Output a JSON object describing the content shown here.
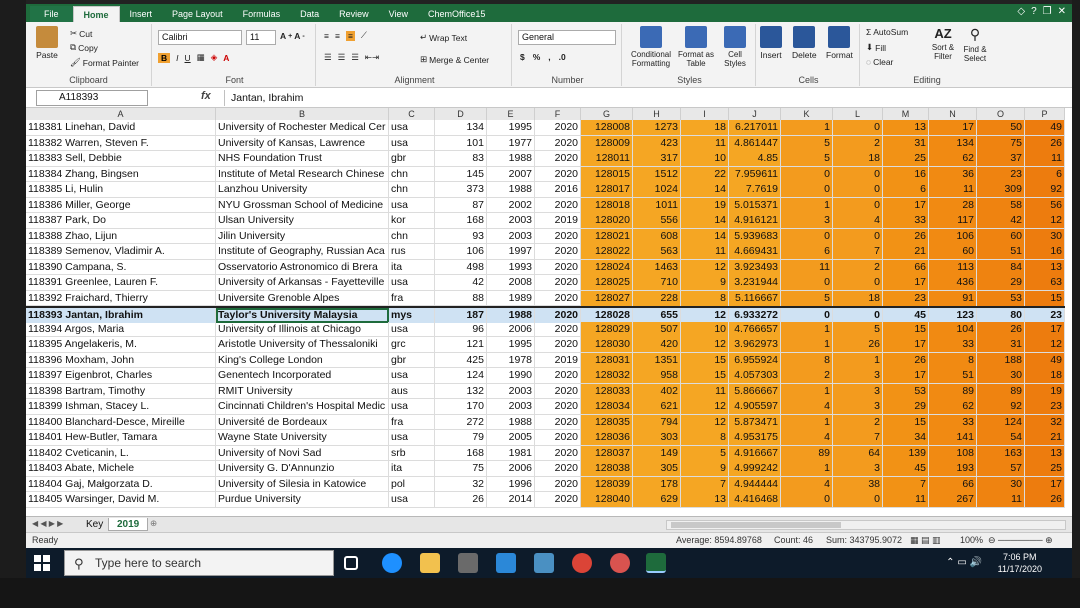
{
  "ribbon_tabs": [
    "File",
    "Home",
    "Insert",
    "Page Layout",
    "Formulas",
    "Data",
    "Review",
    "View",
    "ChemOffice15"
  ],
  "ribbon": {
    "clipboard": {
      "paste": "Paste",
      "cut": "Cut",
      "copy": "Copy",
      "format_painter": "Format Painter",
      "label": "Clipboard"
    },
    "font": {
      "name": "Calibri",
      "size": "11",
      "label": "Font"
    },
    "alignment": {
      "wrap": "Wrap Text",
      "merge": "Merge & Center",
      "label": "Alignment"
    },
    "number": {
      "format": "General",
      "label": "Number"
    },
    "styles": {
      "conditional": "Conditional Formatting",
      "table": "Format as Table",
      "cell": "Cell Styles",
      "label": "Styles"
    },
    "cells": {
      "insert": "Insert",
      "delete": "Delete",
      "format": "Format",
      "label": "Cells"
    },
    "editing": {
      "autosum": "AutoSum",
      "fill": "Fill",
      "clear": "Clear",
      "sort": "Sort & Filter",
      "find": "Find & Select",
      "label": "Editing"
    }
  },
  "formula_bar": {
    "name_box": "A118393",
    "fx": "fx",
    "content": "Jantan, Ibrahim"
  },
  "columns": [
    "A",
    "B",
    "C",
    "D",
    "E",
    "F",
    "G",
    "H",
    "I",
    "J",
    "K",
    "L",
    "M",
    "N",
    "O",
    "P"
  ],
  "rows": [
    {
      "a": "118381 Linehan, David",
      "b": "University of Rochester Medical Cer",
      "c": "usa",
      "d": "134",
      "e": "1995",
      "f": "2020",
      "g": "128008",
      "h": "1273",
      "i": "18",
      "j": "6.217011",
      "k": "1",
      "l": "0",
      "m": "13",
      "n": "17",
      "o": "50",
      "p": "49"
    },
    {
      "a": "118382 Warren, Steven F.",
      "b": "University of Kansas, Lawrence",
      "c": "usa",
      "d": "101",
      "e": "1977",
      "f": "2020",
      "g": "128009",
      "h": "423",
      "i": "11",
      "j": "4.861447",
      "k": "5",
      "l": "2",
      "m": "31",
      "n": "134",
      "o": "75",
      "p": "26"
    },
    {
      "a": "118383 Sell, Debbie",
      "b": "NHS Foundation Trust",
      "c": "gbr",
      "d": "83",
      "e": "1988",
      "f": "2020",
      "g": "128011",
      "h": "317",
      "i": "10",
      "j": "4.85",
      "k": "5",
      "l": "18",
      "m": "25",
      "n": "62",
      "o": "37",
      "p": "11"
    },
    {
      "a": "118384 Zhang, Bingsen",
      "b": "Institute of Metal Research Chinese",
      "c": "chn",
      "d": "145",
      "e": "2007",
      "f": "2020",
      "g": "128015",
      "h": "1512",
      "i": "22",
      "j": "7.959611",
      "k": "0",
      "l": "0",
      "m": "16",
      "n": "36",
      "o": "23",
      "p": "6"
    },
    {
      "a": "118385 Li, Hulin",
      "b": "Lanzhou University",
      "c": "chn",
      "d": "373",
      "e": "1988",
      "f": "2016",
      "g": "128017",
      "h": "1024",
      "i": "14",
      "j": "7.7619",
      "k": "0",
      "l": "0",
      "m": "6",
      "n": "11",
      "o": "309",
      "p": "92"
    },
    {
      "a": "118386 Miller, George",
      "b": "NYU Grossman School of Medicine",
      "c": "usa",
      "d": "87",
      "e": "2002",
      "f": "2020",
      "g": "128018",
      "h": "1011",
      "i": "19",
      "j": "5.015371",
      "k": "1",
      "l": "0",
      "m": "17",
      "n": "28",
      "o": "58",
      "p": "56"
    },
    {
      "a": "118387 Park, Do",
      "b": "Ulsan University",
      "c": "kor",
      "d": "168",
      "e": "2003",
      "f": "2019",
      "g": "128020",
      "h": "556",
      "i": "14",
      "j": "4.916121",
      "k": "3",
      "l": "4",
      "m": "33",
      "n": "117",
      "o": "42",
      "p": "12"
    },
    {
      "a": "118388 Zhao, Lijun",
      "b": "Jilin University",
      "c": "chn",
      "d": "93",
      "e": "2003",
      "f": "2020",
      "g": "128021",
      "h": "608",
      "i": "14",
      "j": "5.939683",
      "k": "0",
      "l": "0",
      "m": "26",
      "n": "106",
      "o": "60",
      "p": "30"
    },
    {
      "a": "118389 Semenov, Vladimir A.",
      "b": "Institute of Geography, Russian Aca",
      "c": "rus",
      "d": "106",
      "e": "1997",
      "f": "2020",
      "g": "128022",
      "h": "563",
      "i": "11",
      "j": "4.669431",
      "k": "6",
      "l": "7",
      "m": "21",
      "n": "60",
      "o": "51",
      "p": "16"
    },
    {
      "a": "118390 Campana, S.",
      "b": "Osservatorio Astronomico di Brera",
      "c": "ita",
      "d": "498",
      "e": "1993",
      "f": "2020",
      "g": "128024",
      "h": "1463",
      "i": "12",
      "j": "3.923493",
      "k": "11",
      "l": "2",
      "m": "66",
      "n": "113",
      "o": "84",
      "p": "13"
    },
    {
      "a": "118391 Greenlee, Lauren F.",
      "b": "University of Arkansas - Fayetteville",
      "c": "usa",
      "d": "42",
      "e": "2008",
      "f": "2020",
      "g": "128025",
      "h": "710",
      "i": "9",
      "j": "3.231944",
      "k": "0",
      "l": "0",
      "m": "17",
      "n": "436",
      "o": "29",
      "p": "63"
    },
    {
      "a": "118392 Fraichard, Thierry",
      "b": "Universite Grenoble Alpes",
      "c": "fra",
      "d": "88",
      "e": "1989",
      "f": "2020",
      "g": "128027",
      "h": "228",
      "i": "8",
      "j": "5.116667",
      "k": "5",
      "l": "18",
      "m": "23",
      "n": "91",
      "o": "53",
      "p": "15"
    },
    {
      "a": "118393 Jantan, Ibrahim",
      "b": "Taylor's University Malaysia",
      "c": "mys",
      "d": "187",
      "e": "1988",
      "f": "2020",
      "g": "128028",
      "h": "655",
      "i": "12",
      "j": "6.933272",
      "k": "0",
      "l": "0",
      "m": "45",
      "n": "123",
      "o": "80",
      "p": "23"
    },
    {
      "a": "118394 Argos, Maria",
      "b": "University of Illinois at Chicago",
      "c": "usa",
      "d": "96",
      "e": "2006",
      "f": "2020",
      "g": "128029",
      "h": "507",
      "i": "10",
      "j": "4.766657",
      "k": "1",
      "l": "5",
      "m": "15",
      "n": "104",
      "o": "26",
      "p": "17"
    },
    {
      "a": "118395 Angelakeris, M.",
      "b": "Aristotle University of Thessaloniki",
      "c": "grc",
      "d": "121",
      "e": "1995",
      "f": "2020",
      "g": "128030",
      "h": "420",
      "i": "12",
      "j": "3.962973",
      "k": "1",
      "l": "26",
      "m": "17",
      "n": "33",
      "o": "31",
      "p": "12"
    },
    {
      "a": "118396 Moxham, John",
      "b": "King's College London",
      "c": "gbr",
      "d": "425",
      "e": "1978",
      "f": "2019",
      "g": "128031",
      "h": "1351",
      "i": "15",
      "j": "6.955924",
      "k": "8",
      "l": "1",
      "m": "26",
      "n": "8",
      "o": "188",
      "p": "49"
    },
    {
      "a": "118397 Eigenbrot, Charles",
      "b": "Genentech Incorporated",
      "c": "usa",
      "d": "124",
      "e": "1990",
      "f": "2020",
      "g": "128032",
      "h": "958",
      "i": "15",
      "j": "4.057303",
      "k": "2",
      "l": "3",
      "m": "17",
      "n": "51",
      "o": "30",
      "p": "18"
    },
    {
      "a": "118398 Bartram, Timothy",
      "b": "RMIT University",
      "c": "aus",
      "d": "132",
      "e": "2003",
      "f": "2020",
      "g": "128033",
      "h": "402",
      "i": "11",
      "j": "5.866667",
      "k": "1",
      "l": "3",
      "m": "53",
      "n": "89",
      "o": "89",
      "p": "19"
    },
    {
      "a": "118399 Ishman, Stacey L.",
      "b": "Cincinnati Children's Hospital Medic",
      "c": "usa",
      "d": "170",
      "e": "2003",
      "f": "2020",
      "g": "128034",
      "h": "621",
      "i": "12",
      "j": "4.905597",
      "k": "4",
      "l": "3",
      "m": "29",
      "n": "62",
      "o": "92",
      "p": "23"
    },
    {
      "a": "118400 Blanchard-Desce, Mireille",
      "b": "Université de Bordeaux",
      "c": "fra",
      "d": "272",
      "e": "1988",
      "f": "2020",
      "g": "128035",
      "h": "794",
      "i": "12",
      "j": "5.873471",
      "k": "1",
      "l": "2",
      "m": "15",
      "n": "33",
      "o": "124",
      "p": "32"
    },
    {
      "a": "118401 Hew-Butler, Tamara",
      "b": "Wayne State University",
      "c": "usa",
      "d": "79",
      "e": "2005",
      "f": "2020",
      "g": "128036",
      "h": "303",
      "i": "8",
      "j": "4.953175",
      "k": "4",
      "l": "7",
      "m": "34",
      "n": "141",
      "o": "54",
      "p": "21"
    },
    {
      "a": "118402 Cveticanin, L.",
      "b": "University of Novi Sad",
      "c": "srb",
      "d": "168",
      "e": "1981",
      "f": "2020",
      "g": "128037",
      "h": "149",
      "i": "5",
      "j": "4.916667",
      "k": "89",
      "l": "64",
      "m": "139",
      "n": "108",
      "o": "163",
      "p": "13"
    },
    {
      "a": "118403 Abate, Michele",
      "b": "University G. D'Annunzio",
      "c": "ita",
      "d": "75",
      "e": "2006",
      "f": "2020",
      "g": "128038",
      "h": "305",
      "i": "9",
      "j": "4.999242",
      "k": "1",
      "l": "3",
      "m": "45",
      "n": "193",
      "o": "57",
      "p": "25"
    },
    {
      "a": "118404 Gaj, Małgorzata D.",
      "b": "University of Silesia in Katowice",
      "c": "pol",
      "d": "32",
      "e": "1996",
      "f": "2020",
      "g": "128039",
      "h": "178",
      "i": "7",
      "j": "4.944444",
      "k": "4",
      "l": "38",
      "m": "7",
      "n": "66",
      "o": "30",
      "p": "17"
    },
    {
      "a": "118405 Warsinger, David M.",
      "b": "Purdue University",
      "c": "usa",
      "d": "26",
      "e": "2014",
      "f": "2020",
      "g": "128040",
      "h": "629",
      "i": "13",
      "j": "4.416468",
      "k": "0",
      "l": "0",
      "m": "11",
      "n": "267",
      "o": "11",
      "p": "26"
    }
  ],
  "sheets": [
    "Key",
    "2019"
  ],
  "status": {
    "ready": "Ready",
    "average": "Average: 8594.89768",
    "count": "Count: 46",
    "sum": "Sum: 343795.9072",
    "zoom": "100%"
  },
  "taskbar": {
    "search_placeholder": "Type here to search",
    "time": "7:06 PM",
    "date": "11/17/2020"
  },
  "colors": {
    "excel_green": "#1e6b3c",
    "orange": "#f5a623",
    "selection": "#cfe2f3"
  }
}
